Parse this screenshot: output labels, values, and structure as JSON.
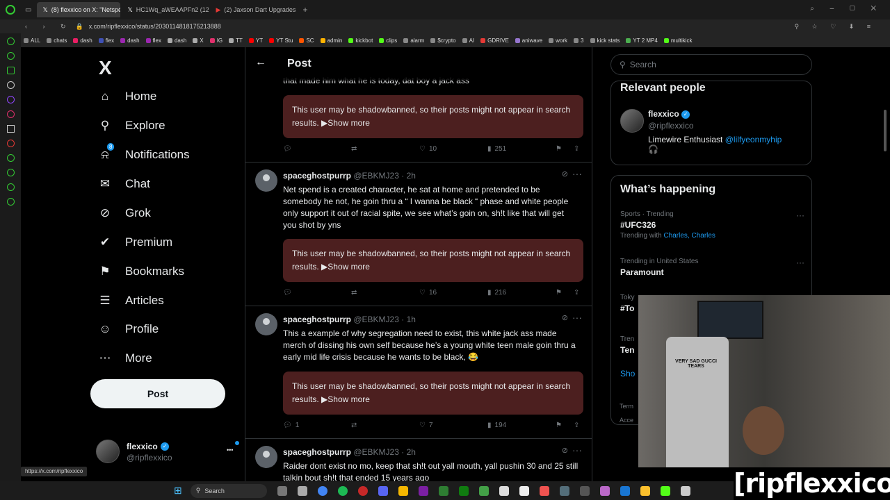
{
  "browser": {
    "tabs": [
      {
        "label": "(8) flexxico on X: \"Netspé",
        "active": true,
        "color": "#fff"
      },
      {
        "label": "HC1Wq_aWEAAPFn2 (120…",
        "active": false,
        "color": "#fff"
      },
      {
        "label": "(2) Jaxson Dart Upgrades",
        "active": false,
        "color": "#e53935"
      }
    ],
    "new_tab": "+",
    "url": "x.com/ripflexxico/status/2030114818175213888",
    "bookmarks": [
      {
        "label": "ALL",
        "color": "#888"
      },
      {
        "label": "chats",
        "color": "#888"
      },
      {
        "label": "dash",
        "color": "#e91e63"
      },
      {
        "label": "flex",
        "color": "#3f51b5"
      },
      {
        "label": "dash",
        "color": "#9c27b0"
      },
      {
        "label": "flex",
        "color": "#9c27b0"
      },
      {
        "label": "dash",
        "color": "#aaa"
      },
      {
        "label": "X",
        "color": "#aaa"
      },
      {
        "label": "IG",
        "color": "#e1306c"
      },
      {
        "label": "TT",
        "color": "#aaa"
      },
      {
        "label": "YT",
        "color": "#f00"
      },
      {
        "label": "YT Stu",
        "color": "#f00"
      },
      {
        "label": "SC",
        "color": "#ff5500"
      },
      {
        "label": "admin",
        "color": "#ffb300"
      },
      {
        "label": "kickbot",
        "color": "#53fc18"
      },
      {
        "label": "clips",
        "color": "#53fc18"
      },
      {
        "label": "alarm",
        "color": "#888"
      },
      {
        "label": "$crypto",
        "color": "#888"
      },
      {
        "label": "AI",
        "color": "#888"
      },
      {
        "label": "GDRIVE",
        "color": "#e53935"
      },
      {
        "label": "aniwave",
        "color": "#9575cd"
      },
      {
        "label": "work",
        "color": "#888"
      },
      {
        "label": "3",
        "color": "#888"
      },
      {
        "label": "kick stats",
        "color": "#888"
      },
      {
        "label": "YT 2 MP4",
        "color": "#4caf50"
      },
      {
        "label": "multikick",
        "color": "#53fc18"
      }
    ],
    "status_url": "https://x.com/ripflexxico"
  },
  "nav": {
    "logo": "X",
    "items": [
      {
        "label": "Home",
        "icon": "home-icon",
        "glyph": "⌂"
      },
      {
        "label": "Explore",
        "icon": "search-icon",
        "glyph": "⚲"
      },
      {
        "label": "Notifications",
        "icon": "bell-icon",
        "glyph": "⍾",
        "badge": "8"
      },
      {
        "label": "Chat",
        "icon": "mail-icon",
        "glyph": "✉"
      },
      {
        "label": "Grok",
        "icon": "grok-icon",
        "glyph": "⊘"
      },
      {
        "label": "Premium",
        "icon": "premium-icon",
        "glyph": "✔"
      },
      {
        "label": "Bookmarks",
        "icon": "bookmark-icon",
        "glyph": "⚑"
      },
      {
        "label": "Articles",
        "icon": "articles-icon",
        "glyph": "☰"
      },
      {
        "label": "Profile",
        "icon": "profile-icon",
        "glyph": "☺"
      },
      {
        "label": "More",
        "icon": "more-icon",
        "glyph": "⋯"
      }
    ],
    "post_button": "Post",
    "account": {
      "name": "flexxico",
      "handle": "@ripflexxico",
      "menu": "•••"
    }
  },
  "feed": {
    "title": "Post",
    "prev_tail": "that made him what he is today, dat boy a jack ass",
    "shadow_text": "This user may be shadowbanned, so their posts might not appear in search results.",
    "show_more": "▶Show more",
    "top_stats": {
      "replies": "",
      "reposts": "",
      "likes": "10",
      "views": "251"
    },
    "tweets": [
      {
        "name": "spaceghostpurrp",
        "handle": "@EBKMJ23",
        "time": "· 2h",
        "text": "Net spend is a created character, he sat at home and pretended to be somebody he not, he goin thru a “ I wanna be black “ phase and white people only support it out of racial spite, we see what’s goin on, sh!t like that will get you shot by yns",
        "replies": "",
        "reposts": "",
        "likes": "16",
        "views": "216"
      },
      {
        "name": "spaceghostpurrp",
        "handle": "@EBKMJ23",
        "time": "· 1h",
        "text": "This a example of why segregation need to exist, this white jack ass made merch of dissing his own self because he’s a young white teen male goin thru a early mid life crisis because he wants to be black, 😂",
        "replies": "1",
        "reposts": "",
        "likes": "7",
        "views": "194"
      },
      {
        "name": "spaceghostpurrp",
        "handle": "@EBKMJ23",
        "time": "· 2h",
        "text": "Raider dont exist no mo, keep that sh!t out yall mouth, yall pushin 30 and 25 still talkin bout sh!t that ended 15 years ago"
      }
    ]
  },
  "right": {
    "search_placeholder": "Search",
    "relevant_title": "Relevant people",
    "person": {
      "name": "flexxico",
      "handle": "@ripflexxico",
      "bio": "Limewire Enthusiast",
      "bio_link": "@lilfyeonmyhip",
      "bio_emoji": "🎧"
    },
    "happening_title": "What’s happening",
    "trends": [
      {
        "category": "Sports · Trending",
        "title": "#UFC326",
        "with_label": "Trending with",
        "with_links": "Charles, Charles"
      },
      {
        "category": "Trending in United States",
        "title": "Paramount",
        "with_label": "",
        "with_links": ""
      },
      {
        "category": "Toky",
        "title": "#To",
        "with_label": "",
        "with_links": ""
      },
      {
        "category": "Tren",
        "title": "Ten",
        "with_label": "",
        "with_links": ""
      }
    ],
    "show_partial": "Sho",
    "footer_partial": [
      "Term",
      "Acce"
    ]
  },
  "webcam": {
    "shirt_text": "VERY SAD GUCCI TEARS"
  },
  "overlay_brand": "[ripflexxico]",
  "taskbar": {
    "search_label": "Search"
  }
}
